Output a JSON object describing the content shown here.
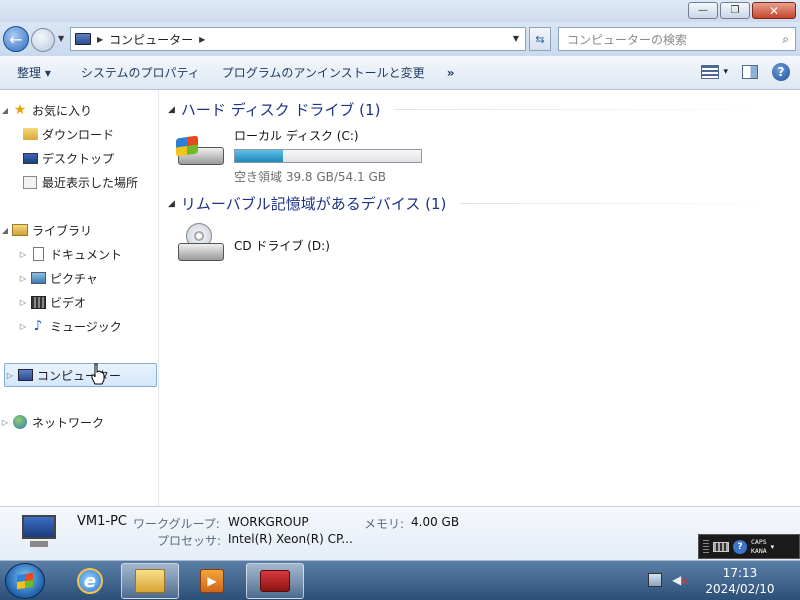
{
  "window": {
    "minimize_label": "—",
    "maximize_label": "❐",
    "close_label": "✕"
  },
  "address": {
    "location": "コンピューター",
    "search_placeholder": "コンピューターの検索"
  },
  "toolbar": {
    "organize": "整理 ▾",
    "system_properties": "システムのプロパティ",
    "uninstall": "プログラムのアンインストールと変更",
    "more": "»",
    "view_dropdown": "▾",
    "help": "?"
  },
  "nav": {
    "favorites": "お気に入り",
    "downloads": "ダウンロード",
    "desktop": "デスクトップ",
    "recent": "最近表示した場所",
    "libraries": "ライブラリ",
    "documents": "ドキュメント",
    "pictures": "ピクチャ",
    "videos": "ビデオ",
    "music": "ミュージック",
    "computer": "コンピューター",
    "network": "ネットワーク"
  },
  "content": {
    "group_hdd": "ハード ディスク ドライブ (1)",
    "group_removable": "リムーバブル記憶域があるデバイス (1)",
    "drive_c": {
      "name": "ローカル ディスク (C:)",
      "free_text": "空き領域 39.8 GB/54.1 GB",
      "used_fraction": 0.26
    },
    "drive_d": {
      "name": "CD ドライブ (D:)"
    }
  },
  "details": {
    "pc_name": "VM1-PC",
    "workgroup_label": "ワークグループ:",
    "workgroup_value": "WORKGROUP",
    "memory_label": "メモリ:",
    "memory_value": "4.00 GB",
    "processor_label": "プロセッサ:",
    "processor_value": "Intel(R) Xeon(R) CP..."
  },
  "ime": {
    "caps": "CAPS",
    "kana": "KANA",
    "help": "?"
  },
  "taskbar": {
    "time": "17:13",
    "date": "2024/02/10",
    "ie_glyph": "e",
    "wmp_glyph": "▶"
  }
}
